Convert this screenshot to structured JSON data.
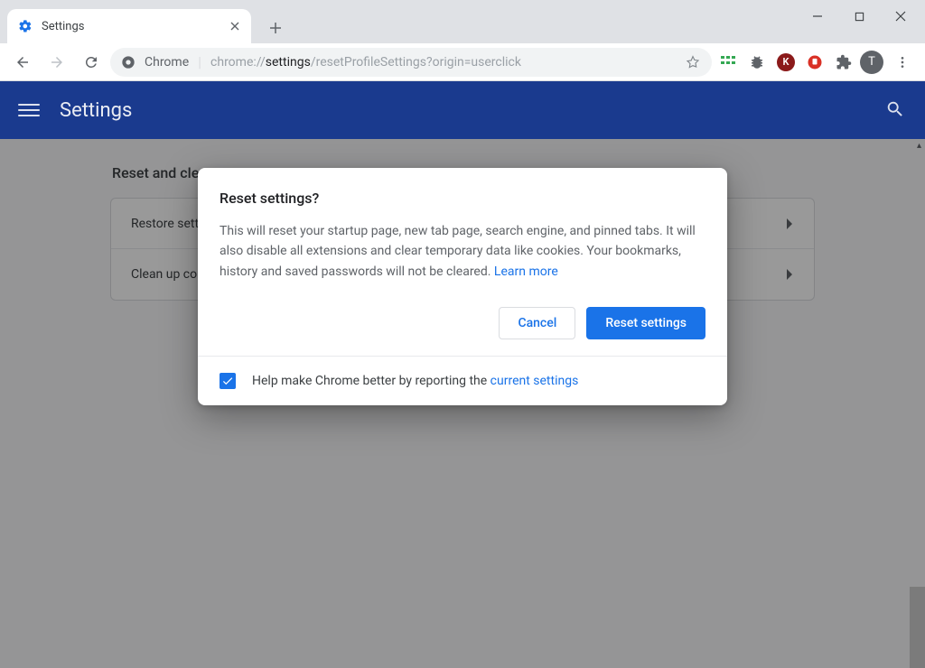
{
  "window": {
    "tab_title": "Settings"
  },
  "toolbar": {
    "chip_label": "Chrome",
    "url_prefix": "chrome://",
    "url_bold": "settings",
    "url_rest": "/resetProfileSettings?origin=userclick",
    "avatar_initial": "T"
  },
  "settings_header": {
    "title": "Settings"
  },
  "content": {
    "section_title": "Reset and clean up",
    "rows": [
      {
        "label": "Restore settings to their original defaults"
      },
      {
        "label": "Clean up computer"
      }
    ]
  },
  "modal": {
    "title": "Reset settings?",
    "body_text": "This will reset your startup page, new tab page, search engine, and pinned tabs. It will also disable all extensions and clear temporary data like cookies. Your bookmarks, history and saved passwords will not be cleared. ",
    "learn_more": "Learn more",
    "cancel": "Cancel",
    "confirm": "Reset settings",
    "footer_prefix": "Help make Chrome better by reporting the ",
    "footer_link": "current settings"
  }
}
